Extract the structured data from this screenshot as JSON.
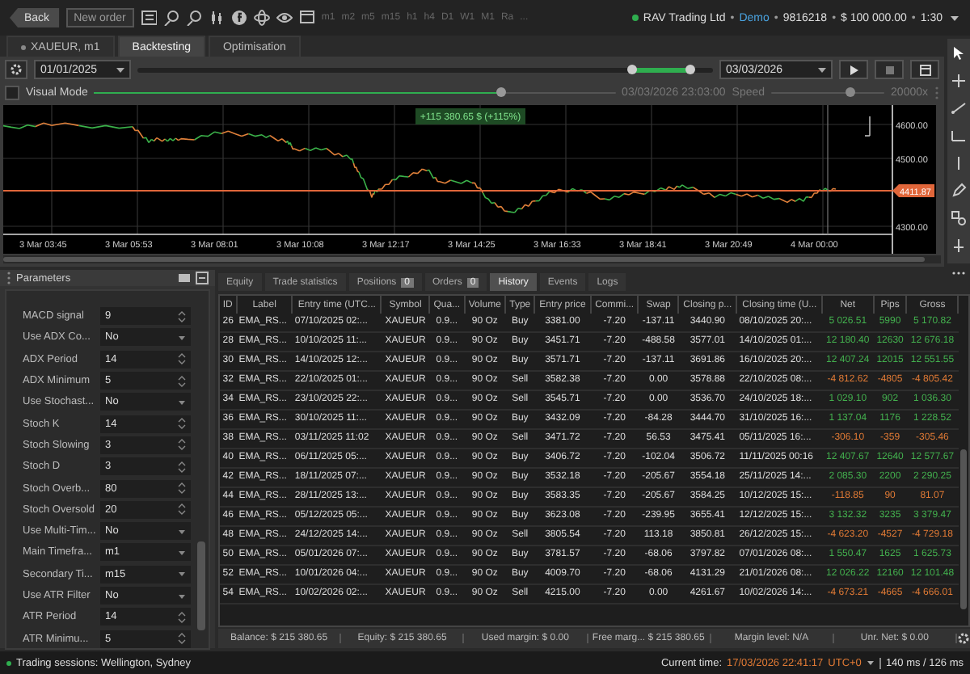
{
  "toolbar": {
    "buttons": [
      {
        "label": "Back",
        "kind": "back"
      },
      {
        "label": "New order",
        "kind": "outline"
      }
    ],
    "timeframes": [
      "m1",
      "m2",
      "m5",
      "m15",
      "h1",
      "h4",
      "D1",
      "W1",
      "M1",
      "Ra"
    ],
    "more": "..."
  },
  "account": {
    "parts": [
      {
        "text": "RAV Trading Ltd",
        "kind": "plain"
      },
      {
        "text": "Demo",
        "kind": "mode"
      },
      {
        "text": "9816218",
        "kind": "plain"
      },
      {
        "text": "$ 100 000.00",
        "kind": "plain"
      },
      {
        "text": "1:30",
        "kind": "plain"
      }
    ],
    "separator": "•"
  },
  "tabs": [
    {
      "label": "XAUEUR, m1",
      "kind": "symbol",
      "selected": false
    },
    {
      "label": "Backtesting",
      "kind": "plain",
      "selected": true
    },
    {
      "label": "Optimisation",
      "kind": "plain",
      "selected": false
    }
  ],
  "backtest": {
    "start_date": "01/01/2025",
    "end_date": "03/03/2026",
    "range": {
      "start": {
        "level": 0.86
      },
      "end": {
        "level": 0.96
      }
    },
    "visual_mode": {
      "label": "Visual Mode",
      "checked": false
    },
    "progress": {
      "level": 0.78
    },
    "progress_time": "03/03/2026 23:03:00",
    "speed_label": "Speed",
    "speed": {
      "level": 0.7
    },
    "speed_value": "20000x"
  },
  "chart": {
    "result": "+115 380.65 $ (+115%)",
    "price": "4411.87",
    "y_ticks": [
      "4600.00",
      "4500.00",
      "4300.00"
    ],
    "x_ticks": [
      "3 Mar 03:45",
      "3 Mar 05:53",
      "3 Mar 08:01",
      "3 Mar 10:08",
      "3 Mar 12:17",
      "3 Mar 14:25",
      "3 Mar 16:33",
      "3 Mar 18:41",
      "3 Mar 20:49",
      "4 Mar 00:00"
    ]
  },
  "parameters": {
    "title": "Parameters",
    "rows": [
      {
        "name": "MACD signal",
        "value": "9",
        "kind": "number"
      },
      {
        "name": "Use ADX Co...",
        "value": "No",
        "kind": "select"
      },
      {
        "name": "ADX Period",
        "value": "14",
        "kind": "number"
      },
      {
        "name": "ADX Minimum",
        "value": "5",
        "kind": "number"
      },
      {
        "name": "Use Stochast...",
        "value": "No",
        "kind": "select"
      },
      {
        "name": "Stoch K",
        "value": "14",
        "kind": "number"
      },
      {
        "name": "Stoch Slowing",
        "value": "3",
        "kind": "number"
      },
      {
        "name": "Stoch D",
        "value": "3",
        "kind": "number"
      },
      {
        "name": "Stoch Overb...",
        "value": "80",
        "kind": "number"
      },
      {
        "name": "Stoch Oversold",
        "value": "20",
        "kind": "number"
      },
      {
        "name": "Use Multi-Tim...",
        "value": "No",
        "kind": "select"
      },
      {
        "name": "Main Timefra...",
        "value": "m1",
        "kind": "select"
      },
      {
        "name": "Secondary Ti...",
        "value": "m15",
        "kind": "select"
      },
      {
        "name": "Use ATR Filter",
        "value": "No",
        "kind": "select"
      },
      {
        "name": "ATR Period",
        "value": "14",
        "kind": "number"
      },
      {
        "name": "ATR Minimu...",
        "value": "5",
        "kind": "number"
      }
    ]
  },
  "history": {
    "tabs": [
      {
        "label": "Equity",
        "selected": false
      },
      {
        "label": "Trade statistics",
        "selected": false
      },
      {
        "label": "Positions",
        "count": "0",
        "selected": false
      },
      {
        "label": "Orders",
        "count": "0",
        "selected": false
      },
      {
        "label": "History",
        "selected": true
      },
      {
        "label": "Events",
        "selected": false
      },
      {
        "label": "Logs",
        "selected": false
      }
    ],
    "columns": [
      "ID",
      "Label",
      "Entry time (UTC...",
      "Symbol",
      "Qua...",
      "Volume",
      "Type",
      "Entry price",
      "Commi...",
      "Swap",
      "Closing p...",
      "Closing time (U...",
      "Net",
      "Pips",
      "Gross"
    ],
    "rows": [
      {
        "loss": false,
        "cells": [
          "26",
          "EMA_RS...",
          "07/10/2025 02:...",
          "XAUEUR",
          "0.9...",
          "90 Oz",
          "Buy",
          "3381.00",
          "-7.20",
          "-137.11",
          "3440.90",
          "08/10/2025 20:...",
          "5 026.51",
          "5990",
          "5 170.82"
        ]
      },
      {
        "loss": false,
        "cells": [
          "28",
          "EMA_RS...",
          "10/10/2025 11:...",
          "XAUEUR",
          "0.9...",
          "90 Oz",
          "Buy",
          "3451.71",
          "-7.20",
          "-488.58",
          "3577.01",
          "14/10/2025 01:...",
          "12 180.40",
          "12630",
          "12 676.18"
        ]
      },
      {
        "loss": false,
        "cells": [
          "30",
          "EMA_RS...",
          "14/10/2025 12:...",
          "XAUEUR",
          "0.9...",
          "90 Oz",
          "Buy",
          "3571.71",
          "-7.20",
          "-137.11",
          "3691.86",
          "16/10/2025 20:...",
          "12 407.24",
          "12015",
          "12 551.55"
        ]
      },
      {
        "loss": true,
        "cells": [
          "32",
          "EMA_RS...",
          "22/10/2025 01:...",
          "XAUEUR",
          "0.9...",
          "90 Oz",
          "Sell",
          "3582.38",
          "-7.20",
          "0.00",
          "3578.88",
          "22/10/2025 08:...",
          "-4 812.62",
          "-4805",
          "-4 805.42"
        ]
      },
      {
        "loss": false,
        "cells": [
          "34",
          "EMA_RS...",
          "23/10/2025 22:...",
          "XAUEUR",
          "0.9...",
          "90 Oz",
          "Sell",
          "3545.71",
          "-7.20",
          "0.00",
          "3536.70",
          "24/10/2025 18:...",
          "1 029.10",
          "902",
          "1 036.30"
        ]
      },
      {
        "loss": false,
        "cells": [
          "36",
          "EMA_RS...",
          "30/10/2025 11:...",
          "XAUEUR",
          "0.9...",
          "90 Oz",
          "Buy",
          "3432.09",
          "-7.20",
          "-84.28",
          "3444.70",
          "31/10/2025 16:...",
          "1 137.04",
          "1176",
          "1 228.52"
        ]
      },
      {
        "loss": true,
        "cells": [
          "38",
          "EMA_RS...",
          "03/11/2025 11:02",
          "XAUEUR",
          "0.9...",
          "90 Oz",
          "Sell",
          "3471.72",
          "-7.20",
          "56.53",
          "3475.41",
          "05/11/2025 16:...",
          "-306.10",
          "-359",
          "-305.46"
        ]
      },
      {
        "loss": false,
        "cells": [
          "40",
          "EMA_RS...",
          "06/11/2025 05:...",
          "XAUEUR",
          "0.9...",
          "90 Oz",
          "Buy",
          "3406.72",
          "-7.20",
          "-102.04",
          "3506.72",
          "11/11/2025 00:16",
          "12 407.67",
          "12640",
          "12 577.67"
        ]
      },
      {
        "loss": false,
        "cells": [
          "42",
          "EMA_RS...",
          "18/11/2025 07:...",
          "XAUEUR",
          "0.9...",
          "90 Oz",
          "Buy",
          "3532.18",
          "-7.20",
          "-205.67",
          "3554.18",
          "25/11/2025 14:...",
          "2 085.30",
          "2200",
          "2 290.25"
        ]
      },
      {
        "loss": true,
        "cells": [
          "44",
          "EMA_RS...",
          "28/11/2025 13:...",
          "XAUEUR",
          "0.9...",
          "90 Oz",
          "Buy",
          "3583.35",
          "-7.20",
          "-205.67",
          "3584.25",
          "10/12/2025 15:...",
          "-118.85",
          "90",
          "81.07"
        ]
      },
      {
        "loss": false,
        "cells": [
          "46",
          "EMA_RS...",
          "05/12/2025 05:...",
          "XAUEUR",
          "0.9...",
          "90 Oz",
          "Buy",
          "3623.08",
          "-7.20",
          "-239.95",
          "3655.41",
          "12/12/2025 15:...",
          "3 132.32",
          "3235",
          "3 379.47"
        ]
      },
      {
        "loss": true,
        "cells": [
          "48",
          "EMA_RS...",
          "24/12/2025 14:...",
          "XAUEUR",
          "0.9...",
          "90 Oz",
          "Sell",
          "3805.54",
          "-7.20",
          "113.18",
          "3850.81",
          "26/12/2025 15:...",
          "-4 623.20",
          "-4527",
          "-4 729.18"
        ]
      },
      {
        "loss": false,
        "cells": [
          "50",
          "EMA_RS...",
          "05/01/2026 07:...",
          "XAUEUR",
          "0.9...",
          "90 Oz",
          "Buy",
          "3781.57",
          "-7.20",
          "-68.06",
          "3797.82",
          "07/01/2026 08:...",
          "1 550.47",
          "1625",
          "1 625.73"
        ]
      },
      {
        "loss": false,
        "cells": [
          "52",
          "EMA_RS...",
          "10/01/2026 04:...",
          "XAUEUR",
          "0.9...",
          "90 Oz",
          "Buy",
          "4009.70",
          "-7.20",
          "-68.06",
          "4131.29",
          "21/01/2026 08:...",
          "12 026.22",
          "12160",
          "12 101.48"
        ]
      },
      {
        "loss": true,
        "cells": [
          "54",
          "EMA_RS...",
          "10/02/2026 02:...",
          "XAUEUR",
          "0.9...",
          "90 Oz",
          "Sell",
          "4215.00",
          "-7.20",
          "0.00",
          "4261.67",
          "10/02/2026 14:...",
          "-4 673.21",
          "-4665",
          "-4 666.01"
        ]
      }
    ],
    "summary": [
      {
        "label": "Balance:",
        "value": "$ 215 380.65"
      },
      {
        "label": "Equity:",
        "value": "$ 215 380.65"
      },
      {
        "label": "Used margin:",
        "value": "$ 0.00"
      },
      {
        "label": "Free marg...",
        "value": "$ 215 380.65"
      },
      {
        "label": "Margin level:",
        "value": "N/A"
      },
      {
        "label": "Unr. Net:",
        "value": "$ 0.00"
      }
    ]
  },
  "status_bar": {
    "sessions": "Trading sessions: Wellington, Sydney",
    "time_label": "Current time:",
    "time": "17/03/2026 22:41:17",
    "timezone": "UTC+0",
    "latency": "140 ms / 126 ms"
  }
}
